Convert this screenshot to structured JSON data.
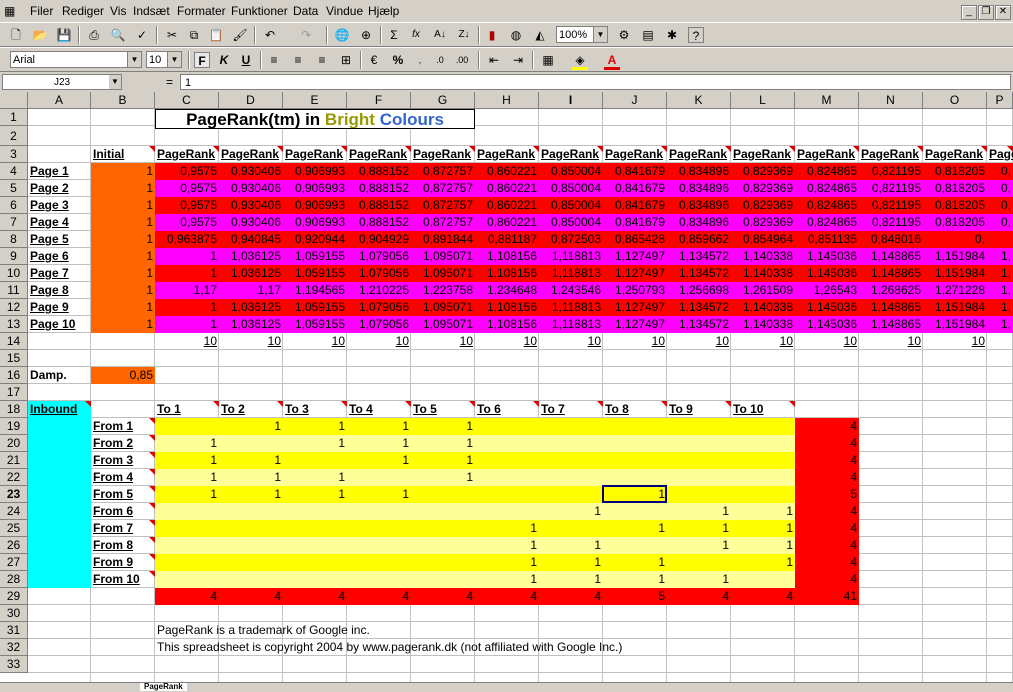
{
  "menu": [
    "Filer",
    "Rediger",
    "Vis",
    "Indsæt",
    "Formater",
    "Funktioner",
    "Data",
    "Vindue",
    "Hjælp"
  ],
  "toolbar": {
    "zoom": "100%",
    "font": "Arial",
    "size": "10",
    "bold": "F",
    "italic": "K",
    "underline": "U",
    "percent": "%",
    "sigma": "Σ",
    "fx": "fx"
  },
  "formula": {
    "cell": "J23",
    "equals": "=",
    "content": "1"
  },
  "columns": [
    "A",
    "B",
    "C",
    "D",
    "E",
    "F",
    "G",
    "H",
    "I",
    "J",
    "K",
    "L",
    "M",
    "N",
    "O",
    "P"
  ],
  "rows": [
    "1",
    "2",
    "3",
    "4",
    "5",
    "6",
    "7",
    "8",
    "9",
    "10",
    "11",
    "12",
    "13",
    "14",
    "15",
    "16",
    "17",
    "18",
    "19",
    "20",
    "21",
    "22",
    "23",
    "24",
    "25",
    "26",
    "27",
    "28",
    "29",
    "30",
    "31",
    "32",
    "33"
  ],
  "title": {
    "prefix": "PageRank(tm) in ",
    "bright": "Bright",
    "colours": "Colours"
  },
  "initial_label": "Initial",
  "pr_header": "PageRank",
  "pages": [
    "Page 1",
    "Page 2",
    "Page 3",
    "Page 4",
    "Page 5",
    "Page 6",
    "Page 7",
    "Page 8",
    "Page 9",
    "Page 10"
  ],
  "pr_values": [
    [
      "1",
      "0,9575",
      "0,930406",
      "0,906993",
      "0,888152",
      "0,872757",
      "0,860221",
      "0,850004",
      "0,841679",
      "0,834896",
      "0,829369",
      "0,824865",
      "0,821195",
      "0,818205",
      "0,"
    ],
    [
      "1",
      "0,9575",
      "0,930406",
      "0,906993",
      "0,888152",
      "0,872757",
      "0,860221",
      "0,850004",
      "0,841679",
      "0,834896",
      "0,829369",
      "0,824865",
      "0,821195",
      "0,818205",
      "0,"
    ],
    [
      "1",
      "0,9575",
      "0,930406",
      "0,906993",
      "0,888152",
      "0,872757",
      "0,860221",
      "0,850004",
      "0,841679",
      "0,834896",
      "0,829369",
      "0,824865",
      "0,821195",
      "0,818205",
      "0,"
    ],
    [
      "1",
      "0,9575",
      "0,930406",
      "0,906993",
      "0,888152",
      "0,872757",
      "0,860221",
      "0,850004",
      "0,841679",
      "0,834896",
      "0,829369",
      "0,824865",
      "0,821195",
      "0,818205",
      "0,"
    ],
    [
      "1",
      "0,963875",
      "0,940845",
      "0,920944",
      "0,904929",
      "0,891844",
      "0,881187",
      "0,872503",
      "0,865428",
      "0,859662",
      "0,854964",
      "0,851135",
      "0,848016",
      "0,"
    ],
    [
      "1",
      "1",
      "1,036125",
      "1,059155",
      "1,079056",
      "1,095071",
      "1,108156",
      "1,118813",
      "1,127497",
      "1,134572",
      "1,140338",
      "1,145036",
      "1,148865",
      "1,151984",
      "1,"
    ],
    [
      "1",
      "1",
      "1,036125",
      "1,059155",
      "1,079056",
      "1,095071",
      "1,108156",
      "1,118813",
      "1,127497",
      "1,134572",
      "1,140338",
      "1,145036",
      "1,148865",
      "1,151984",
      "1,"
    ],
    [
      "1",
      "1,17",
      "1,17",
      "1,194565",
      "1,210225",
      "1,223758",
      "1,234648",
      "1,243546",
      "1,250793",
      "1,256698",
      "1,261509",
      "1,26543",
      "1,268625",
      "1,271228",
      "1,"
    ],
    [
      "1",
      "1",
      "1,036125",
      "1,059155",
      "1,079056",
      "1,095071",
      "1,108156",
      "1,118813",
      "1,127497",
      "1,134572",
      "1,140338",
      "1,145036",
      "1,148865",
      "1,151984",
      "1,"
    ],
    [
      "1",
      "1",
      "1,036125",
      "1,059155",
      "1,079056",
      "1,095071",
      "1,108156",
      "1,118813",
      "1,127497",
      "1,134572",
      "1,140338",
      "1,145036",
      "1,148865",
      "1,151984",
      "1,"
    ]
  ],
  "sum_row": [
    "10",
    "10",
    "10",
    "10",
    "10",
    "10",
    "10",
    "10",
    "10",
    "10",
    "10",
    "10",
    "10"
  ],
  "damp": {
    "label": "Damp.",
    "value": "0,85"
  },
  "inbound_label": "Inbound",
  "to_labels": [
    "To 1",
    "To 2",
    "To 3",
    "To 4",
    "To 5",
    "To 6",
    "To 7",
    "To 8",
    "To 9",
    "To 10"
  ],
  "from_labels": [
    "From 1",
    "From 2",
    "From 3",
    "From 4",
    "From 5",
    "From 6",
    "From 7",
    "From 8",
    "From 9",
    "From 10"
  ],
  "matrix": [
    [
      "",
      "1",
      "1",
      "1",
      "1",
      "",
      "",
      "",
      "",
      ""
    ],
    [
      "1",
      "",
      "1",
      "1",
      "1",
      "",
      "",
      "",
      "",
      ""
    ],
    [
      "1",
      "1",
      "",
      "1",
      "1",
      "",
      "",
      "",
      "",
      ""
    ],
    [
      "1",
      "1",
      "1",
      "",
      "1",
      "",
      "",
      "",
      "",
      ""
    ],
    [
      "1",
      "1",
      "1",
      "1",
      "",
      "",
      "",
      "1",
      "",
      ""
    ],
    [
      "",
      "",
      "",
      "",
      "",
      "",
      "1",
      "",
      "1",
      "1"
    ],
    [
      "",
      "",
      "",
      "",
      "",
      "1",
      "",
      "1",
      "1",
      "1"
    ],
    [
      "",
      "",
      "",
      "",
      "",
      "1",
      "1",
      "",
      "1",
      "1"
    ],
    [
      "",
      "",
      "",
      "",
      "",
      "1",
      "1",
      "1",
      "",
      "1"
    ],
    [
      "",
      "",
      "",
      "",
      "",
      "1",
      "1",
      "1",
      "1",
      ""
    ]
  ],
  "row_totals": [
    "4",
    "4",
    "4",
    "4",
    "5",
    "4",
    "4",
    "4",
    "4",
    "4"
  ],
  "col_totals": [
    "4",
    "4",
    "4",
    "4",
    "4",
    "4",
    "4",
    "5",
    "4",
    "4"
  ],
  "grand_total": "41",
  "footer1": "PageRank is a trademark of Google inc.",
  "footer2": "This spreadsheet is copyright 2004 by www.pagerank.dk (not affiliated with Google Inc.)",
  "sheet_tab": "PageRank"
}
